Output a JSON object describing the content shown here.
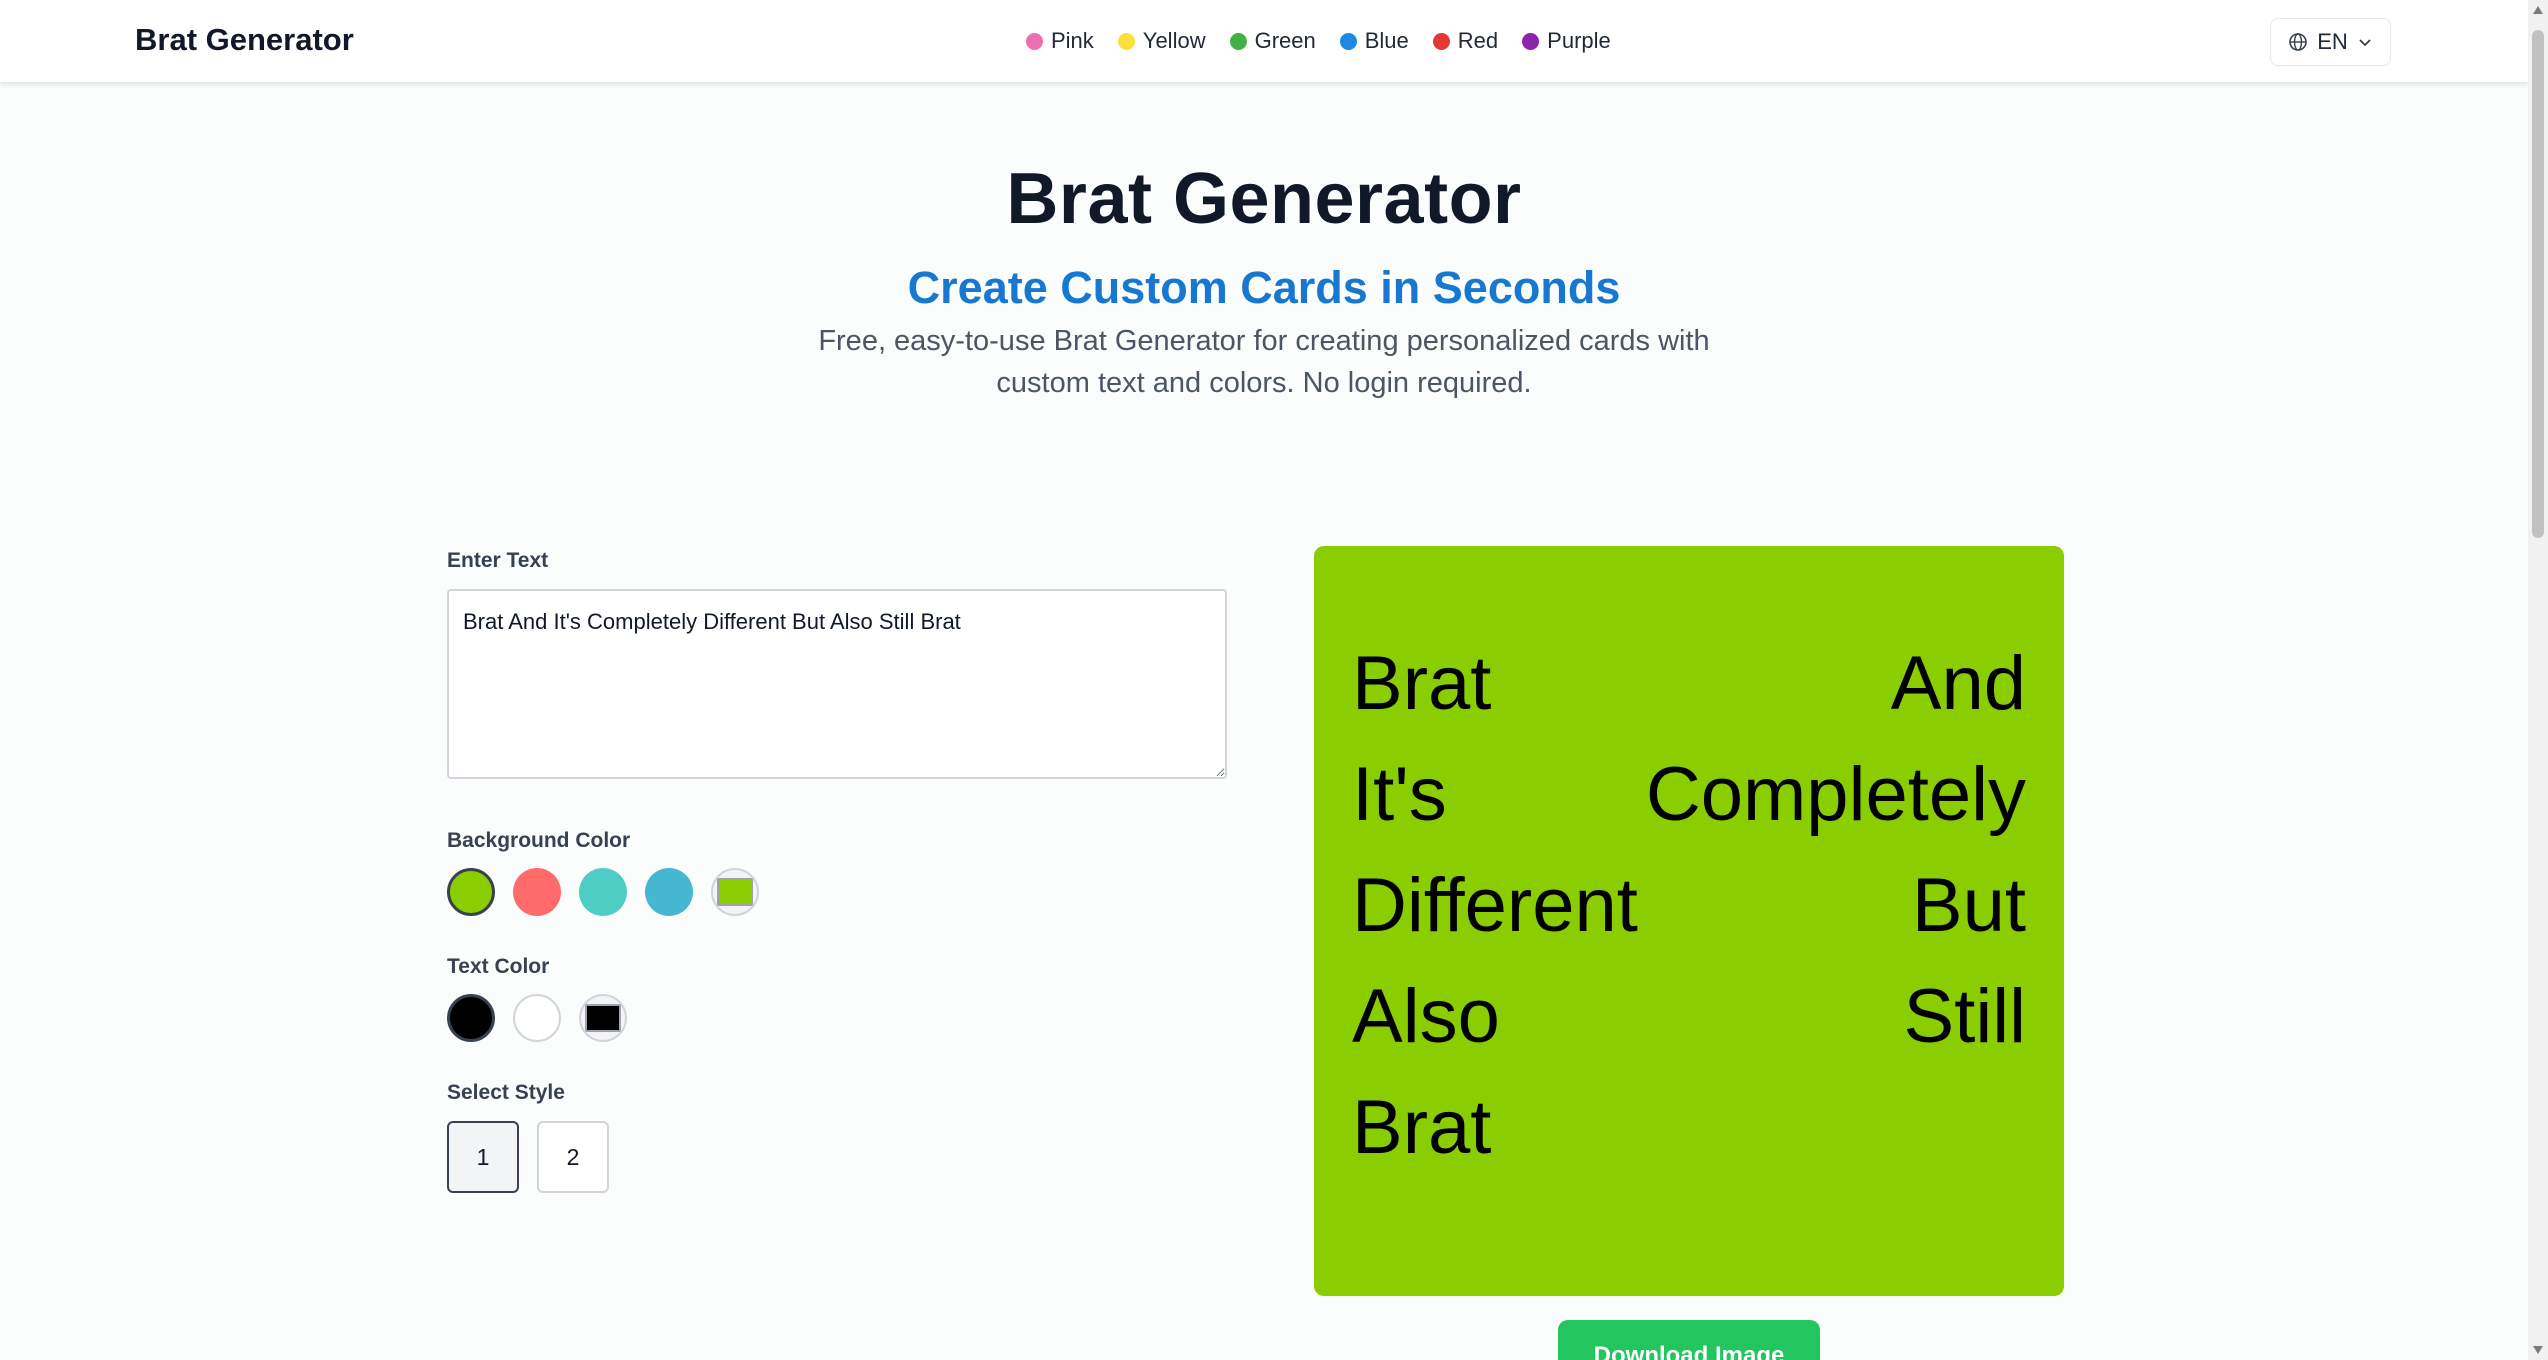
{
  "header": {
    "brand": "Brat Generator",
    "nav": [
      {
        "label": "Pink",
        "color": "#ec6fb0"
      },
      {
        "label": "Yellow",
        "color": "#fde13a"
      },
      {
        "label": "Green",
        "color": "#43b047"
      },
      {
        "label": "Blue",
        "color": "#1e88e5"
      },
      {
        "label": "Red",
        "color": "#e53935"
      },
      {
        "label": "Purple",
        "color": "#8e24aa"
      }
    ],
    "language": "EN",
    "language_icon": "globe-icon"
  },
  "hero": {
    "title": "Brat Generator",
    "subtitle": "Create Custom Cards in Seconds",
    "description": "Free, easy-to-use Brat Generator for creating personalized cards with custom text and colors. No login required."
  },
  "editor": {
    "text_label": "Enter Text",
    "text_value": "Brat And It's Completely Different But Also Still Brat",
    "background_label": "Background Color",
    "background_colors": [
      "#8acd00",
      "#ff6b6b",
      "#4ecdc4",
      "#45b7d1"
    ],
    "background_selected": "#8acd00",
    "text_color_label": "Text Color",
    "text_colors": [
      "#000000",
      "#ffffff"
    ],
    "text_color_selected": "#000000",
    "style_label": "Select Style",
    "styles": [
      "1",
      "2"
    ],
    "style_selected": "1"
  },
  "preview": {
    "lines": [
      [
        "Brat",
        "And"
      ],
      [
        "It's",
        "Completely"
      ],
      [
        "Different",
        "But"
      ],
      [
        "Also",
        "Still"
      ],
      [
        "Brat",
        ""
      ]
    ]
  },
  "actions": {
    "download_label": "Download Image"
  },
  "colors": {
    "accent_subtitle": "#1678d0",
    "download_button": "#22c55e"
  }
}
